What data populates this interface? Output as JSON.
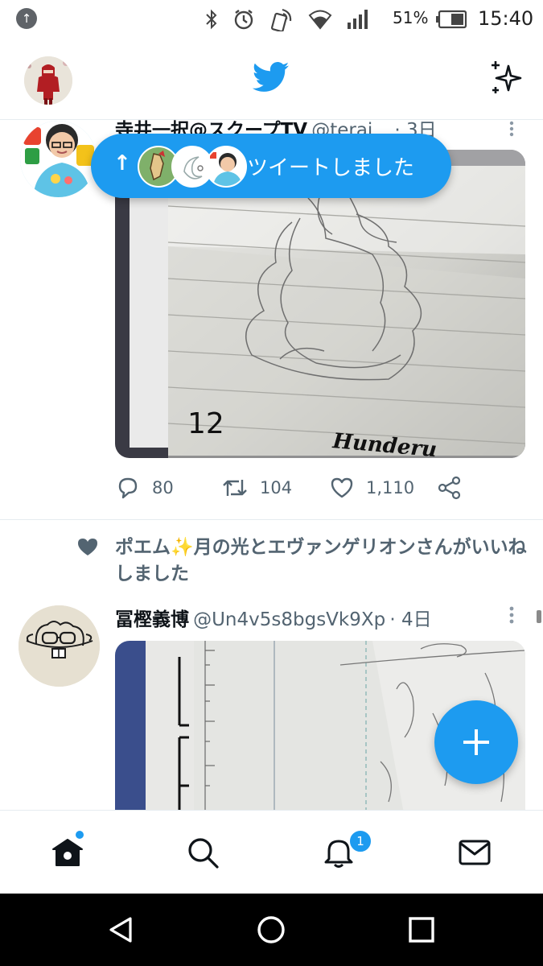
{
  "status_bar": {
    "left_icon": "upload-notification-icon",
    "battery_percent": "51%",
    "time": "15:40",
    "icons": [
      "bluetooth-icon",
      "alarm-icon",
      "nfc-icon",
      "wifi-icon",
      "signal-icon",
      "battery-icon"
    ]
  },
  "header": {
    "logo": "twitter-bird-icon",
    "sparkle": "sparkle-icon"
  },
  "new_tweets_pill": {
    "label": "ツイートしました"
  },
  "tweet1": {
    "name_partial": "寺井一択@スクープTV",
    "handle_partial": "@terai...",
    "time": "· 3日",
    "actions": {
      "reply_count": "80",
      "retweet_count": "104",
      "like_count": "1,110"
    },
    "media_text": {
      "number": "12",
      "signature": "Hunderu"
    }
  },
  "social_context": {
    "text": "ポエム✨月の光とエヴァンゲリオンさんがいいねしました"
  },
  "tweet2": {
    "name": "冨樫義博",
    "handle": "@Un4v5s8bgsVk9Xp",
    "time": "· 4日"
  },
  "bottom_nav": {
    "items": [
      "home-icon",
      "search-icon",
      "notifications-icon",
      "messages-icon"
    ],
    "notification_badge": "1"
  },
  "colors": {
    "accent": "#1d9bf0",
    "text_secondary": "#536471"
  }
}
